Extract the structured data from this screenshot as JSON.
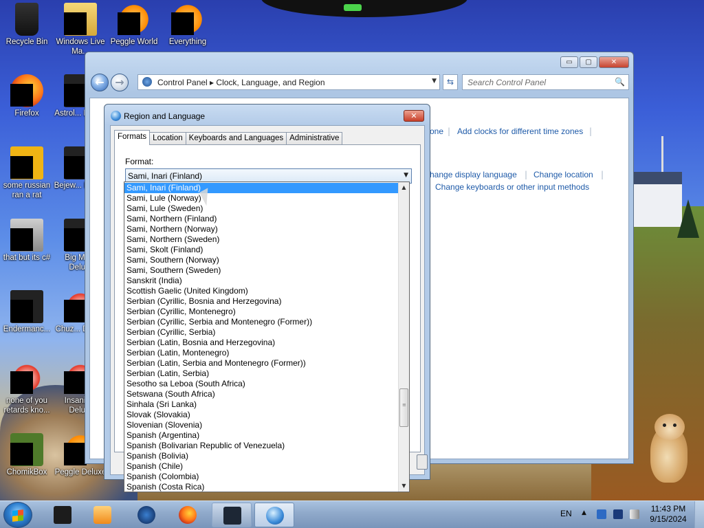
{
  "desktop": {
    "icons": [
      {
        "label": "Recycle Bin"
      },
      {
        "label": "Windows Live Ma..."
      },
      {
        "label": "Peggle World"
      },
      {
        "label": "Everything"
      },
      {
        "label": "Firefox"
      },
      {
        "label": "Astrol... Delu..."
      },
      {
        "label": "some russian ran a rat"
      },
      {
        "label": "Bejew... Delu..."
      },
      {
        "label": "that but its c#"
      },
      {
        "label": "Big Mo... Delu..."
      },
      {
        "label": "Endermanc..."
      },
      {
        "label": "Chuz... Delu..."
      },
      {
        "label": "none of you retards kno..."
      },
      {
        "label": "Insaniq... Delu..."
      },
      {
        "label": "ChomikBox"
      },
      {
        "label": "Peggle Deluxe"
      }
    ]
  },
  "control_panel": {
    "caption": {
      "minimize": "▭",
      "maximize": "▢",
      "close": "✕"
    },
    "address": {
      "path": "Control Panel  ▸  Clock, Language, and Region"
    },
    "search_placeholder": "Search Control Panel",
    "links": {
      "partial_one": "one",
      "add_clocks": "Add clocks for different time zones",
      "change_display_language": "hange display language",
      "change_location": "Change location",
      "change_keyboards": "Change keyboards or other input methods"
    }
  },
  "dialog": {
    "title": "Region and Language",
    "close": "✕",
    "tabs": [
      {
        "label": "Formats",
        "active": true
      },
      {
        "label": "Location",
        "active": false
      },
      {
        "label": "Keyboards and Languages",
        "active": false
      },
      {
        "label": "Administrative",
        "active": false
      }
    ],
    "format_label": "Format:",
    "format_value": "Sami, Inari (Finland)"
  },
  "format_list": {
    "selected_index": 0,
    "items": [
      "Sami, Inari (Finland)",
      "Sami, Lule (Norway)",
      "Sami, Lule (Sweden)",
      "Sami, Northern (Finland)",
      "Sami, Northern (Norway)",
      "Sami, Northern (Sweden)",
      "Sami, Skolt (Finland)",
      "Sami, Southern (Norway)",
      "Sami, Southern (Sweden)",
      "Sanskrit (India)",
      "Scottish Gaelic (United Kingdom)",
      "Serbian (Cyrillic, Bosnia and Herzegovina)",
      "Serbian (Cyrillic, Montenegro)",
      "Serbian (Cyrillic, Serbia and Montenegro (Former))",
      "Serbian (Cyrillic, Serbia)",
      "Serbian (Latin, Bosnia and Herzegovina)",
      "Serbian (Latin, Montenegro)",
      "Serbian (Latin, Serbia and Montenegro (Former))",
      "Serbian (Latin, Serbia)",
      "Sesotho sa Leboa (South Africa)",
      "Setswana (South Africa)",
      "Sinhala (Sri Lanka)",
      "Slovak (Slovakia)",
      "Slovenian (Slovenia)",
      "Spanish (Argentina)",
      "Spanish (Bolivarian Republic of Venezuela)",
      "Spanish (Bolivia)",
      "Spanish (Chile)",
      "Spanish (Colombia)",
      "Spanish (Costa Rica)"
    ]
  },
  "taskbar": {
    "language": "EN",
    "time": "11:43 PM",
    "date": "9/15/2024"
  },
  "colors": {
    "selection": "#3399ff",
    "link": "#1e5aa8",
    "taskbar": "#8fa9ca"
  }
}
